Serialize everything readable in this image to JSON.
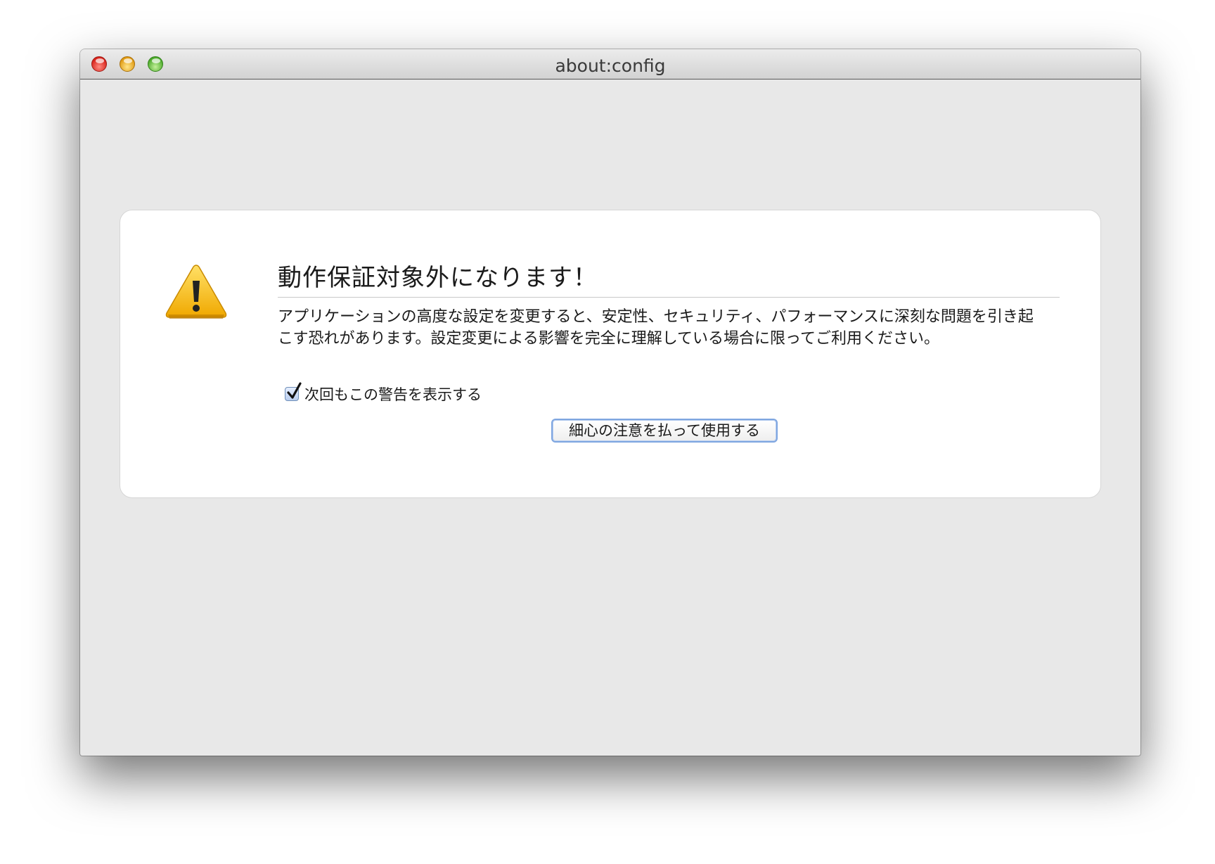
{
  "window": {
    "title": "about:config"
  },
  "warning": {
    "icon": "warning-icon",
    "heading": "動作保証対象外になります！",
    "description": "アプリケーションの高度な設定を変更すると、安定性、セキュリティ、パフォーマンスに深刻な問題を引き起こす恐れがあります。設定変更による影響を完全に理解している場合に限ってご利用ください。",
    "checkbox_label": "次回もこの警告を表示する",
    "checkbox_checked": true,
    "button_label": "細心の注意を払って使用する"
  },
  "colors": {
    "window_bg": "#e8e8e8",
    "card_bg": "#ffffff",
    "accent": "#7fa6e0",
    "warning_yellow": "#f5c100"
  }
}
